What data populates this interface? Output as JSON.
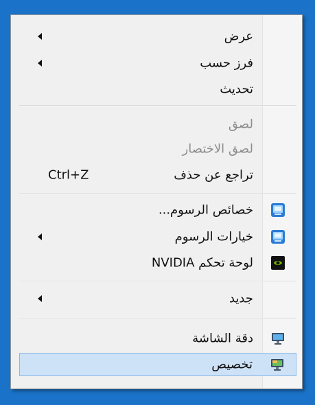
{
  "menu": {
    "view": "عرض",
    "sort_by": "فرز حسب",
    "refresh": "تحديث",
    "paste": "لصق",
    "paste_shortcut": "لصق الاختصار",
    "undo_delete": "تراجع عن حذف",
    "undo_shortcut": "Ctrl+Z",
    "graphics_properties": "خصائص الرسوم...",
    "graphics_options": "خيارات الرسوم",
    "nvidia_control_panel": "لوحة تحكم NVIDIA",
    "new": "جديد",
    "screen_resolution": "دقة الشاشة",
    "personalize": "تخصيص"
  },
  "icons": {
    "graphics_properties": "intel-graphics-icon",
    "graphics_options": "intel-graphics-icon",
    "nvidia_control_panel": "nvidia-icon",
    "screen_resolution": "monitor-icon",
    "personalize": "personalize-icon"
  },
  "colors": {
    "desktop_background": "#1a73c8",
    "menu_background": "#f0f0f0",
    "highlight": "#cde2f6",
    "disabled_text": "#8d8d8d"
  }
}
